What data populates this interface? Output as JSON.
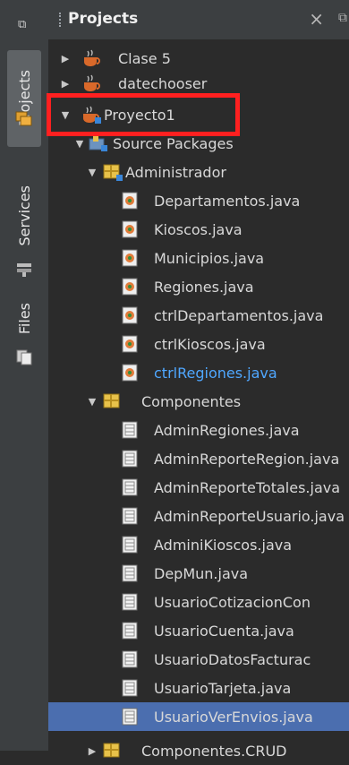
{
  "side_strip": {
    "tabs": [
      "Projects",
      "Services",
      "Files"
    ]
  },
  "panel": {
    "title": "Projects",
    "close": "×"
  },
  "tree": [
    {
      "label": "Clase 5",
      "icon": "java-project-icon",
      "arrow": "▶"
    },
    {
      "label": "datechooser",
      "icon": "java-project-icon",
      "arrow": "▶"
    },
    {
      "label": "Proyecto1",
      "icon": "java-project-icon",
      "arrow": "▼"
    },
    {
      "label": "Source Packages",
      "icon": "source-packages-icon",
      "arrow": "▼"
    },
    {
      "label": "Administrador",
      "icon": "package-icon",
      "arrow": "▼"
    },
    {
      "label": "Departamentos.java",
      "icon": "java-class-icon"
    },
    {
      "label": "Kioscos.java",
      "icon": "java-class-icon"
    },
    {
      "label": "Municipios.java",
      "icon": "java-class-icon"
    },
    {
      "label": "Regiones.java",
      "icon": "java-class-icon"
    },
    {
      "label": "ctrlDepartamentos.java",
      "icon": "java-class-icon"
    },
    {
      "label": "ctrlKioscos.java",
      "icon": "java-class-icon"
    },
    {
      "label": "ctrlRegiones.java",
      "icon": "java-class-icon"
    },
    {
      "label": "Componentes",
      "icon": "package-icon",
      "arrow": "▼"
    },
    {
      "label": "AdminRegiones.java",
      "icon": "form-icon"
    },
    {
      "label": "AdminReporteRegion.java",
      "icon": "form-icon"
    },
    {
      "label": "AdminReporteTotales.java",
      "icon": "form-icon"
    },
    {
      "label": "AdminReporteUsuario.java",
      "icon": "form-icon"
    },
    {
      "label": "AdminiKioscos.java",
      "icon": "form-icon"
    },
    {
      "label": "DepMun.java",
      "icon": "form-icon"
    },
    {
      "label": "UsuarioCotizacionCon",
      "icon": "form-icon"
    },
    {
      "label": "UsuarioCuenta.java",
      "icon": "form-icon"
    },
    {
      "label": "UsuarioDatosFacturac",
      "icon": "form-icon"
    },
    {
      "label": "UsuarioTarjeta.java",
      "icon": "form-icon"
    },
    {
      "label": "UsuarioVerEnvios.java",
      "icon": "form-icon"
    },
    {
      "label": "Componentes.CRUD",
      "icon": "package-icon",
      "arrow": "▶"
    }
  ]
}
